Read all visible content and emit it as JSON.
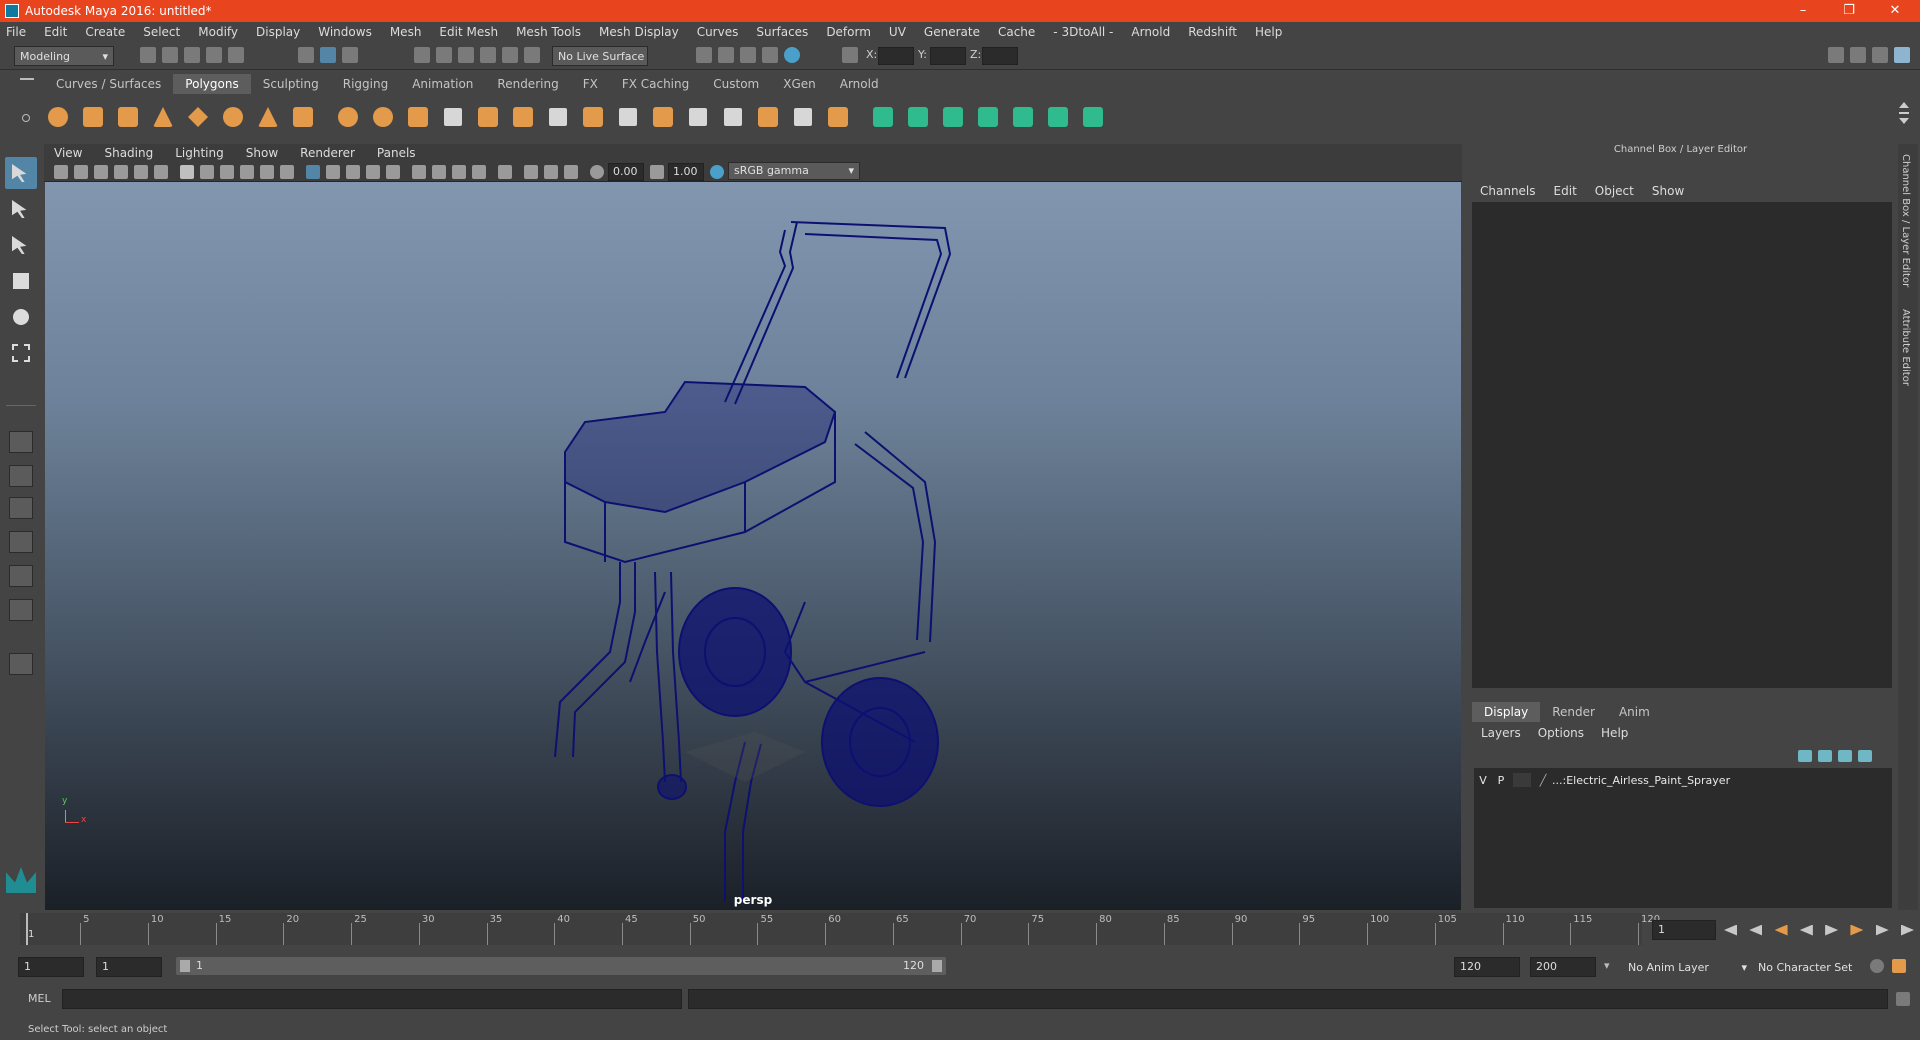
{
  "window": {
    "title": "Autodesk Maya 2016: untitled*"
  },
  "menubar": [
    "File",
    "Edit",
    "Create",
    "Select",
    "Modify",
    "Display",
    "Windows",
    "Mesh",
    "Edit Mesh",
    "Mesh Tools",
    "Mesh Display",
    "Curves",
    "Surfaces",
    "Deform",
    "UV",
    "Generate",
    "Cache",
    "- 3DtoAll -",
    "Arnold",
    "Redshift",
    "Help"
  ],
  "statusline": {
    "menuset": "Modeling",
    "live_surface": "No Live Surface",
    "x_label": "X:",
    "y_label": "Y:",
    "z_label": "Z:"
  },
  "shelf_tabs": [
    "Curves / Surfaces",
    "Polygons",
    "Sculpting",
    "Rigging",
    "Animation",
    "Rendering",
    "FX",
    "FX Caching",
    "Custom",
    "XGen",
    "Arnold"
  ],
  "shelf_active": "Polygons",
  "viewport": {
    "menu": [
      "View",
      "Shading",
      "Lighting",
      "Show",
      "Renderer",
      "Panels"
    ],
    "exposure": "0.00",
    "gamma": "1.00",
    "colorspace": "sRGB gamma",
    "camera_label": "persp",
    "axis_y": "y",
    "axis_x": "x",
    "wire_color": "#0d1070"
  },
  "right_panel": {
    "header": "Channel Box / Layer Editor",
    "menu": [
      "Channels",
      "Edit",
      "Object",
      "Show"
    ],
    "layer_tabs": [
      "Display",
      "Render",
      "Anim"
    ],
    "layer_menu": [
      "Layers",
      "Options",
      "Help"
    ],
    "layer": {
      "v": "V",
      "p": "P",
      "name": "...:Electric_Airless_Paint_Sprayer"
    },
    "side_tab_1": "Channel Box / Layer Editor",
    "side_tab_2": "Attribute Editor"
  },
  "timeline": {
    "ticks": [
      "5",
      "10",
      "15",
      "20",
      "25",
      "30",
      "35",
      "40",
      "45",
      "50",
      "55",
      "60",
      "65",
      "70",
      "75",
      "80",
      "85",
      "90",
      "95",
      "100",
      "105",
      "110",
      "115",
      "120"
    ],
    "current": "1",
    "start_marker": "1"
  },
  "range": {
    "start": "1",
    "playback_start": "1",
    "slider_start": "1",
    "slider_end": "120",
    "playback_end": "120",
    "end": "200",
    "anim_layer": "No Anim Layer",
    "char_set": "No Character Set"
  },
  "mel_label": "MEL",
  "status_text": "Select Tool: select an object",
  "colors": {
    "titlebar": "#e8451f",
    "accent": "#5285a6",
    "shelf_orange": "#e39a4a"
  }
}
